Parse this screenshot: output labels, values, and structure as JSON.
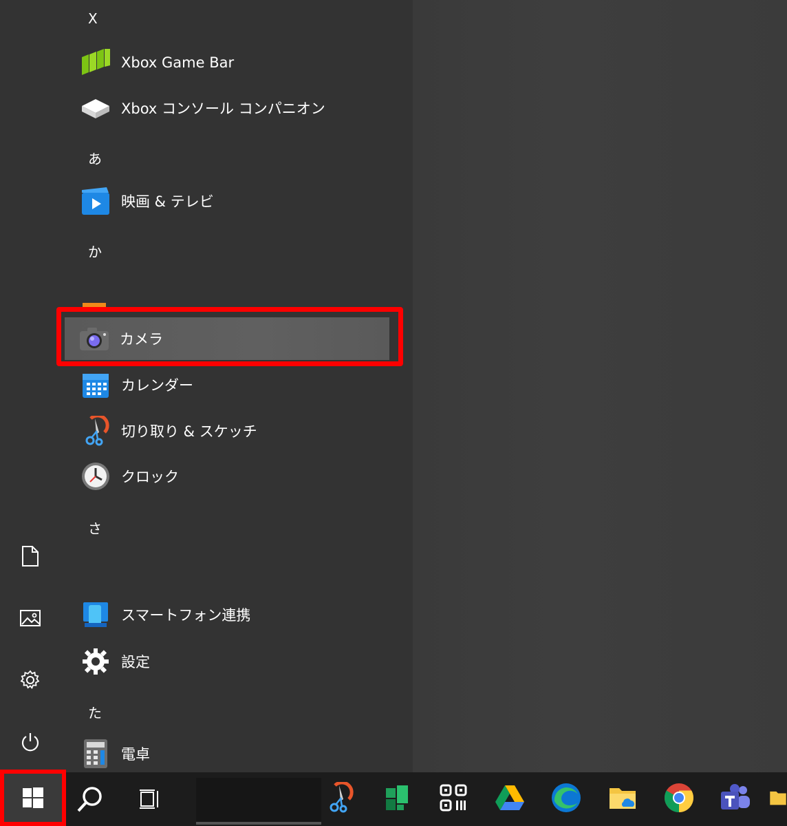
{
  "start_menu": {
    "groups": [
      {
        "letter": "X",
        "apps": [
          {
            "label": "Xbox Game Bar",
            "icon": "xbox-game-bar-icon"
          },
          {
            "label": "Xbox コンソール コンパニオン",
            "icon": "xbox-console-icon"
          }
        ]
      },
      {
        "letter": "あ",
        "apps": [
          {
            "label": "映画 & テレビ",
            "icon": "movies-tv-icon"
          }
        ]
      },
      {
        "letter": "か",
        "apps": [
          {
            "label": "カメラ",
            "icon": "camera-icon",
            "highlighted": true
          },
          {
            "label": "カレンダー",
            "icon": "calendar-icon"
          },
          {
            "label": "切り取り & スケッチ",
            "icon": "snip-sketch-icon"
          },
          {
            "label": "クロック",
            "icon": "clock-icon"
          }
        ]
      },
      {
        "letter": "さ",
        "apps": [
          {
            "label": "スマートフォン連携",
            "icon": "phone-link-icon"
          },
          {
            "label": "設定",
            "icon": "settings-gear-icon"
          }
        ]
      },
      {
        "letter": "た",
        "apps": [
          {
            "label": "電卓",
            "icon": "calculator-icon"
          }
        ]
      }
    ],
    "rail": [
      "document-icon",
      "pictures-icon",
      "settings-icon",
      "power-icon"
    ]
  },
  "taskbar": {
    "items": [
      "windows-start-icon",
      "search-icon",
      "task-view-icon",
      "snip-sketch-icon",
      "planner-icon",
      "qr-scanner-icon",
      "google-drive-icon",
      "edge-icon",
      "file-explorer-icon",
      "chrome-icon",
      "teams-icon",
      "folder-icon"
    ]
  },
  "colors": {
    "highlight": "#ff0000",
    "menu_bg": "#333333",
    "taskbar_bg": "#1c1c1c"
  }
}
